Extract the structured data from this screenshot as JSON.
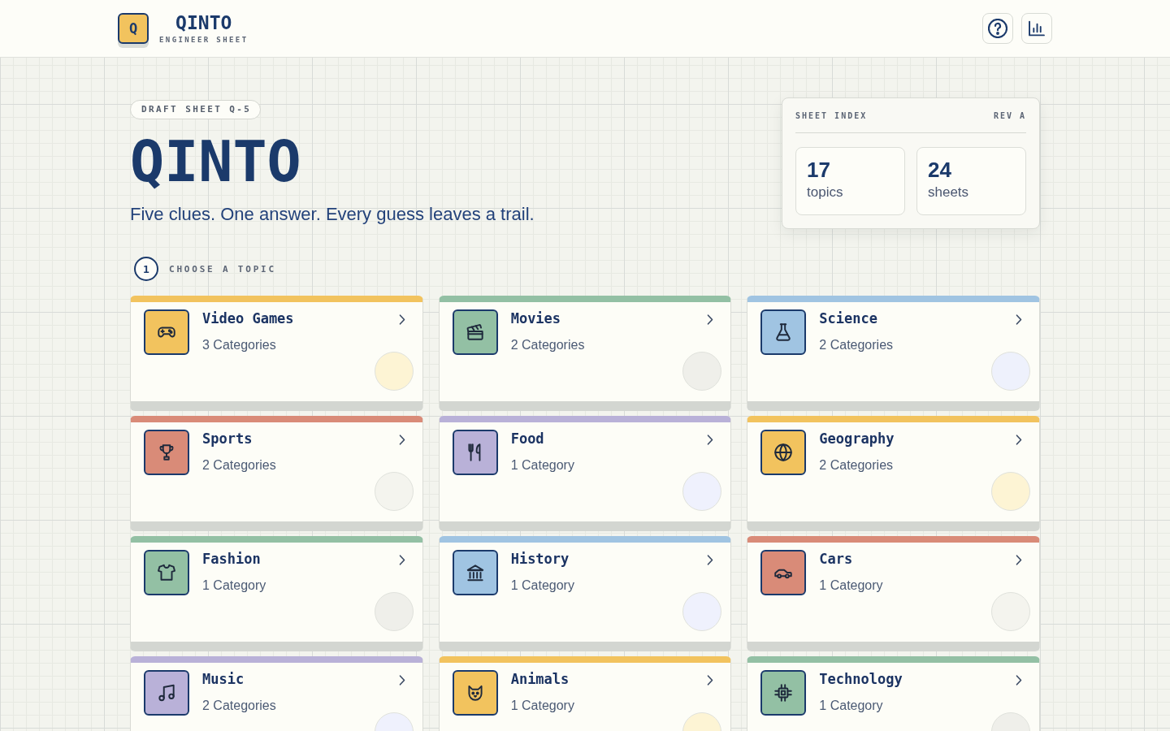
{
  "header": {
    "logo_letter": "Q",
    "title": "QINTO",
    "subtitle": "ENGINEER SHEET"
  },
  "hero": {
    "badge": "DRAFT SHEET Q-5",
    "title": "QINTO",
    "tagline": "Five clues. One answer. Every guess leaves a trail."
  },
  "sheet_index": {
    "title": "SHEET INDEX",
    "revision": "REV A",
    "stats": [
      {
        "value": "17",
        "label": "topics"
      },
      {
        "value": "24",
        "label": "sheets"
      }
    ]
  },
  "step": {
    "number": "1",
    "label": "CHOOSE A TOPIC"
  },
  "topics": [
    {
      "name": "Video Games",
      "count": "3 Categories",
      "color": "#f2c35e",
      "circle": {
        "color": "#fdf4d4"
      }
    },
    {
      "name": "Movies",
      "count": "2 Categories",
      "color": "#93c0a4",
      "circle": {
        "color": "#efefea"
      }
    },
    {
      "name": "Science",
      "count": "2 Categories",
      "color": "#a0c4e2",
      "circle": {
        "color": "#eef1fc"
      }
    },
    {
      "name": "Sports",
      "count": "2 Categories",
      "color": "#d98b78",
      "circle": {
        "color": "#f4f4ee"
      }
    },
    {
      "name": "Food",
      "count": "1 Category",
      "color": "#b9b1d8",
      "circle": {
        "color": "#eff1fd"
      }
    },
    {
      "name": "Geography",
      "count": "2 Categories",
      "color": "#f2c35e",
      "circle": {
        "color": "#fdf4d4"
      }
    },
    {
      "name": "Fashion",
      "count": "1 Category",
      "color": "#93c0a4",
      "circle": {
        "color": "#efefea"
      }
    },
    {
      "name": "History",
      "count": "1 Category",
      "color": "#a0c4e2",
      "circle": {
        "color": "#eff1fd"
      }
    },
    {
      "name": "Cars",
      "count": "1 Category",
      "color": "#d98b78",
      "circle": {
        "color": "#f4f4ee"
      }
    },
    {
      "name": "Music",
      "count": "2 Categories",
      "color": "#b9b1d8",
      "circle": {
        "color": "#eff1fd"
      }
    },
    {
      "name": "Animals",
      "count": "1 Category",
      "color": "#f2c35e",
      "circle": {
        "color": "#fdf4d4"
      }
    },
    {
      "name": "Technology",
      "count": "1 Category",
      "color": "#93c0a4",
      "circle": {
        "color": "#efefea"
      }
    }
  ]
}
